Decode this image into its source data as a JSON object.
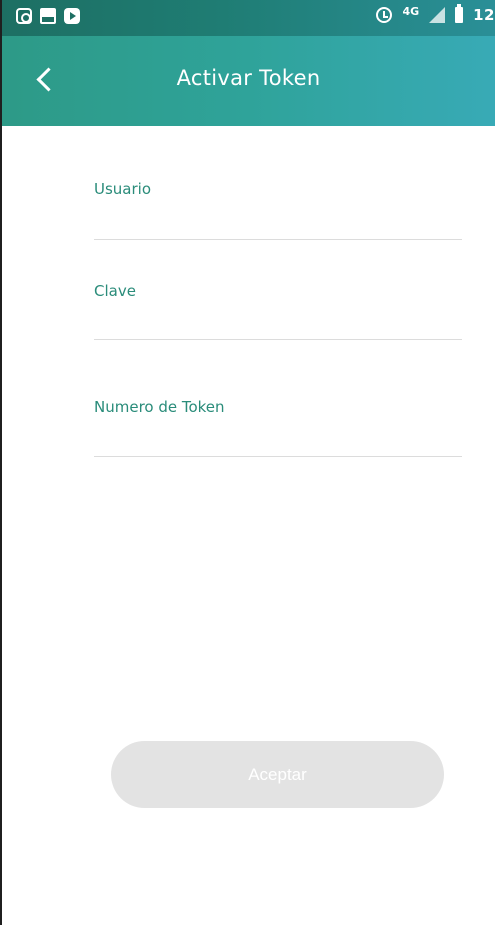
{
  "status_bar": {
    "icons_left": [
      "instagram-icon",
      "gallery-icon",
      "youtube-icon"
    ],
    "network_label": "4G",
    "time": "12"
  },
  "app_bar": {
    "title": "Activar Token",
    "back_icon": "chevron-left-icon"
  },
  "form": {
    "fields": [
      {
        "label": "Usuario",
        "value": ""
      },
      {
        "label": "Clave",
        "value": ""
      },
      {
        "label": "Numero de Token",
        "value": ""
      }
    ],
    "submit_label": "Aceptar"
  },
  "colors": {
    "accent": "#2a8c7a",
    "header_gradient_start": "#2d9a87",
    "header_gradient_end": "#38aab6",
    "button_disabled": "#e3e3e3"
  }
}
